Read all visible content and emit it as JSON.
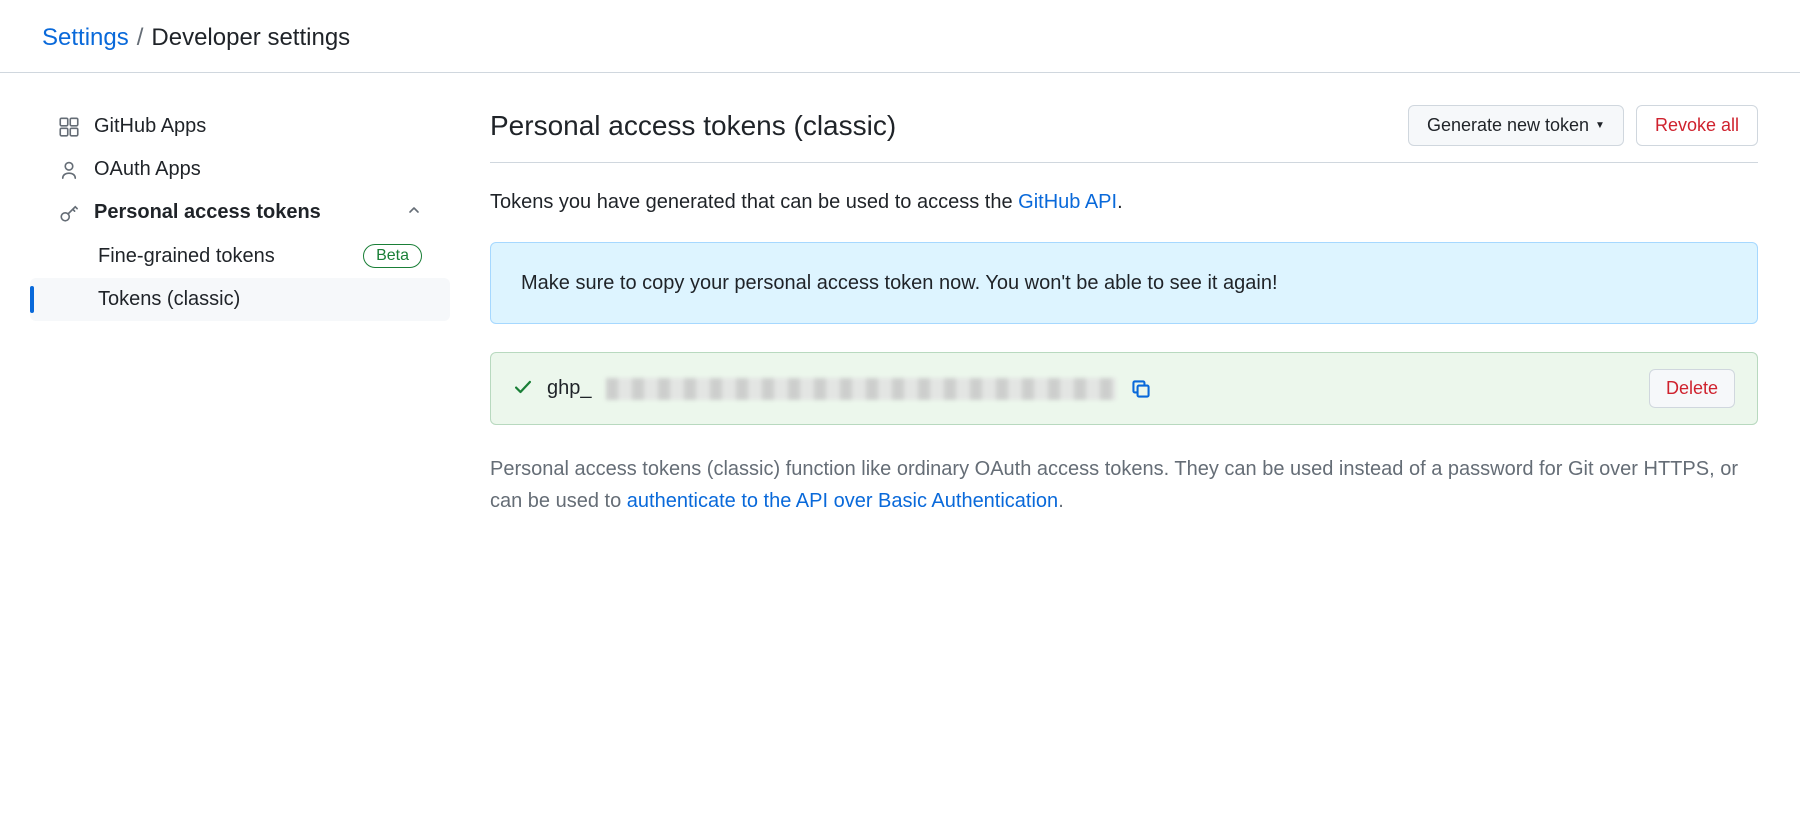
{
  "breadcrumb": {
    "root": "Settings",
    "sep": "/",
    "current": "Developer settings"
  },
  "sidebar": {
    "items": [
      {
        "label": "GitHub Apps"
      },
      {
        "label": "OAuth Apps"
      },
      {
        "label": "Personal access tokens"
      }
    ],
    "sub_items": [
      {
        "label": "Fine-grained tokens",
        "badge": "Beta"
      },
      {
        "label": "Tokens (classic)"
      }
    ]
  },
  "main": {
    "title": "Personal access tokens (classic)",
    "generate_label": "Generate new token",
    "revoke_label": "Revoke all",
    "intro_prefix": "Tokens you have generated that can be used to access the ",
    "intro_link": "GitHub API",
    "intro_suffix": ".",
    "info_message": "Make sure to copy your personal access token now. You won't be able to see it again!",
    "token_prefix": "ghp_",
    "delete_label": "Delete",
    "footer_prefix": "Personal access tokens (classic) function like ordinary OAuth access tokens. They can be used instead of a password for Git over HTTPS, or can be used to ",
    "footer_link": "authenticate to the API over Basic Authentication",
    "footer_suffix": "."
  }
}
